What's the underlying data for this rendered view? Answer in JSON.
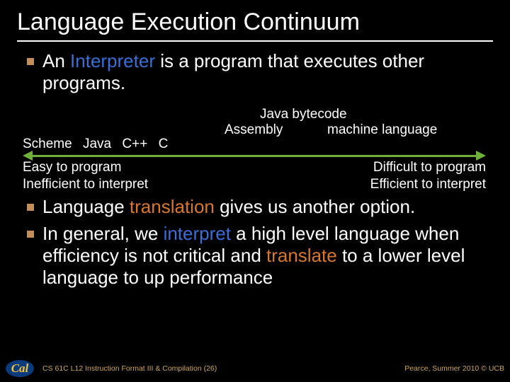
{
  "title": "Language Execution Continuum",
  "bullets_top": [
    {
      "pre": "An ",
      "kw": "Interpreter",
      "kw_class": "kw-blue",
      "post": " is a program that executes other programs."
    }
  ],
  "continuum": {
    "top_label_left": "Java bytecode",
    "top_label_asm": "Assembly",
    "top_label_right": "machine language",
    "langs": [
      "Scheme",
      "Java",
      "C++",
      "C"
    ],
    "ease_left_1": "Easy to program",
    "ease_left_2": "Inefficient to interpret",
    "ease_right_1": "Difficult to program",
    "ease_right_2": "Efficient to interpret"
  },
  "bullets_bottom": [
    {
      "pre": "Language ",
      "kw": "translation",
      "kw_class": "kw-orange",
      "post": " gives us another option."
    },
    {
      "pre": "In general, we ",
      "kw": "interpret",
      "kw_class": "kw-blue",
      "mid": " a high level language when efficiency is not critical and ",
      "kw2": "translate",
      "kw2_class": "kw-orange",
      "post2": " to a lower level language to up performance"
    }
  ],
  "footer": {
    "logo_text": "Cal",
    "left": "CS 61C L12 Instruction Format III & Compilation (26)",
    "right": "Pearce, Summer 2010 © UCB"
  }
}
